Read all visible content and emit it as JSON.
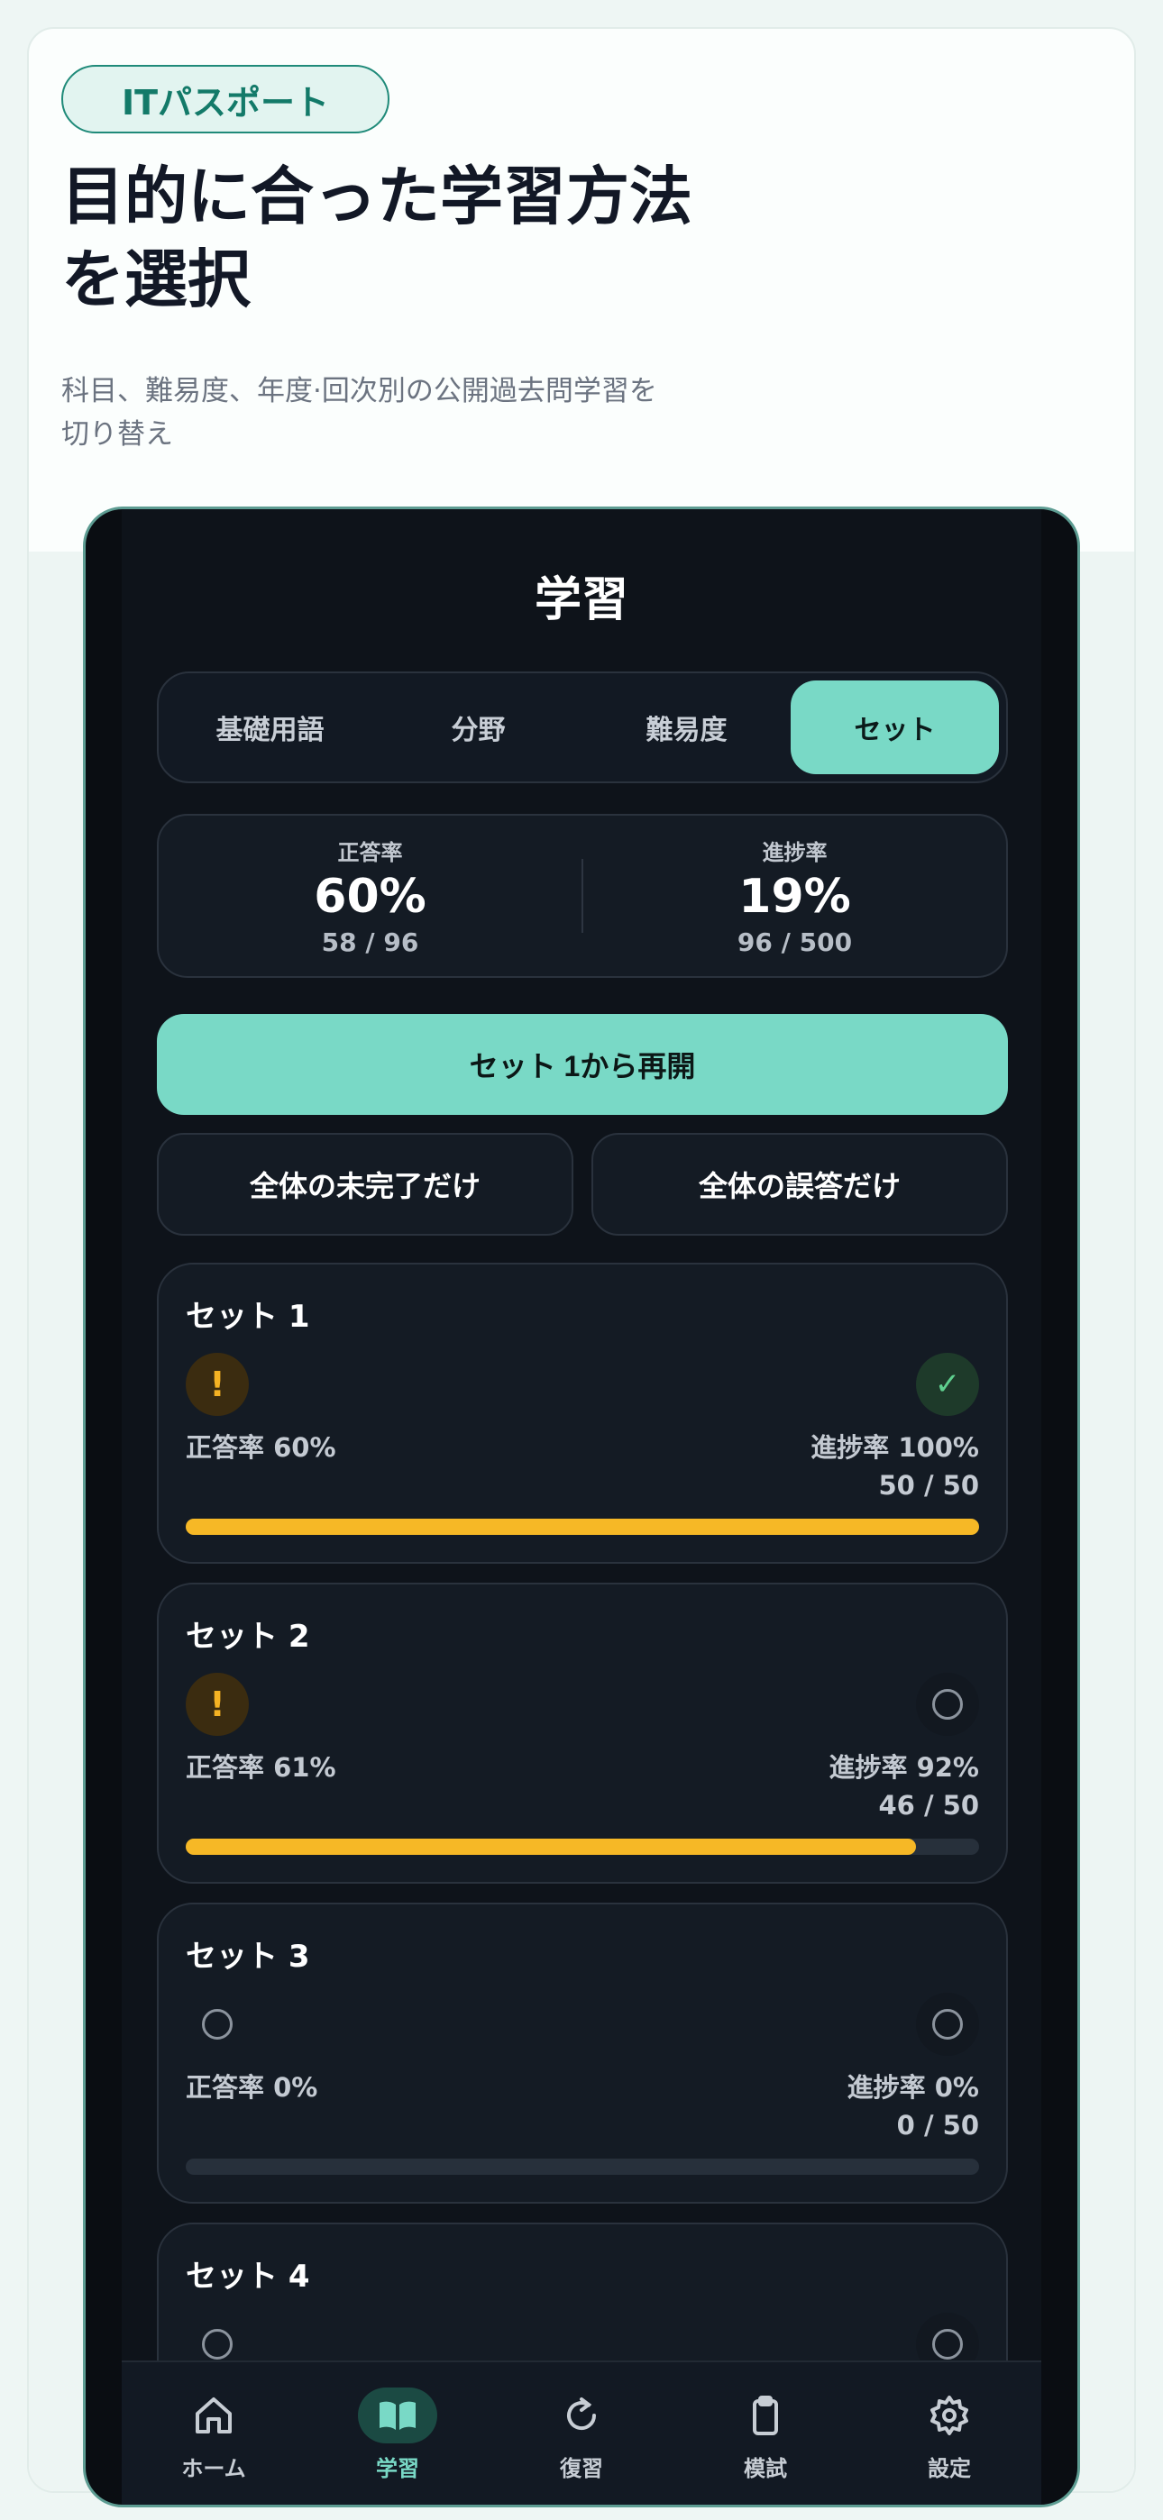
{
  "hero": {
    "badge": "ITパスポート",
    "headline_line1": "目的に合った学習方法",
    "headline_line2": "を選択",
    "subtext_line1": "科目、難易度、年度·回次別の公開過去問学習を",
    "subtext_line2": "切り替え"
  },
  "screen": {
    "title": "学習",
    "segments": [
      {
        "label": "基礎用語",
        "active": false
      },
      {
        "label": "分野",
        "active": false
      },
      {
        "label": "難易度",
        "active": false
      },
      {
        "label": "セット",
        "active": true
      }
    ],
    "stats": {
      "accuracy_label": "正答率",
      "accuracy_value": "60%",
      "accuracy_sub": "58 / 96",
      "progress_label": "進捗率",
      "progress_value": "19%",
      "progress_sub": "96 / 500"
    },
    "resume_button": "セット 1から再開",
    "filter_incomplete": "全体の未完了だけ",
    "filter_wrong": "全体の誤答だけ"
  },
  "sets": [
    {
      "title": "セット 1",
      "accuracy": "正答率 60%",
      "progress": "進捗率 100%",
      "count": "50 / 50",
      "progress_fraction": 1.0,
      "left_icon": "warning-icon",
      "right_icon": "check-icon"
    },
    {
      "title": "セット 2",
      "accuracy": "正答率 61%",
      "progress": "進捗率 92%",
      "count": "46 / 50",
      "progress_fraction": 0.92,
      "left_icon": "warning-icon",
      "right_icon": "empty-circle-icon"
    },
    {
      "title": "セット 3",
      "accuracy": "正答率 0%",
      "progress": "進捗率 0%",
      "count": "0 / 50",
      "progress_fraction": 0.0,
      "left_icon": "empty-circle-icon",
      "right_icon": "empty-circle-icon"
    },
    {
      "title": "セット 4",
      "left_icon": "empty-circle-icon",
      "right_icon": "empty-circle-icon"
    }
  ],
  "tabbar": [
    {
      "label": "ホーム",
      "icon": "home-icon",
      "active": false
    },
    {
      "label": "学習",
      "icon": "book-icon",
      "active": true
    },
    {
      "label": "復習",
      "icon": "refresh-icon",
      "active": false
    },
    {
      "label": "模試",
      "icon": "clipboard-icon",
      "active": false
    },
    {
      "label": "設定",
      "icon": "gear-icon",
      "active": false
    }
  ],
  "colors": {
    "accent": "#79d9c6",
    "progress_bar": "#f6b826",
    "warning": "#f4b223",
    "success": "#5fd08f",
    "screen_bg": "#0e131a"
  }
}
